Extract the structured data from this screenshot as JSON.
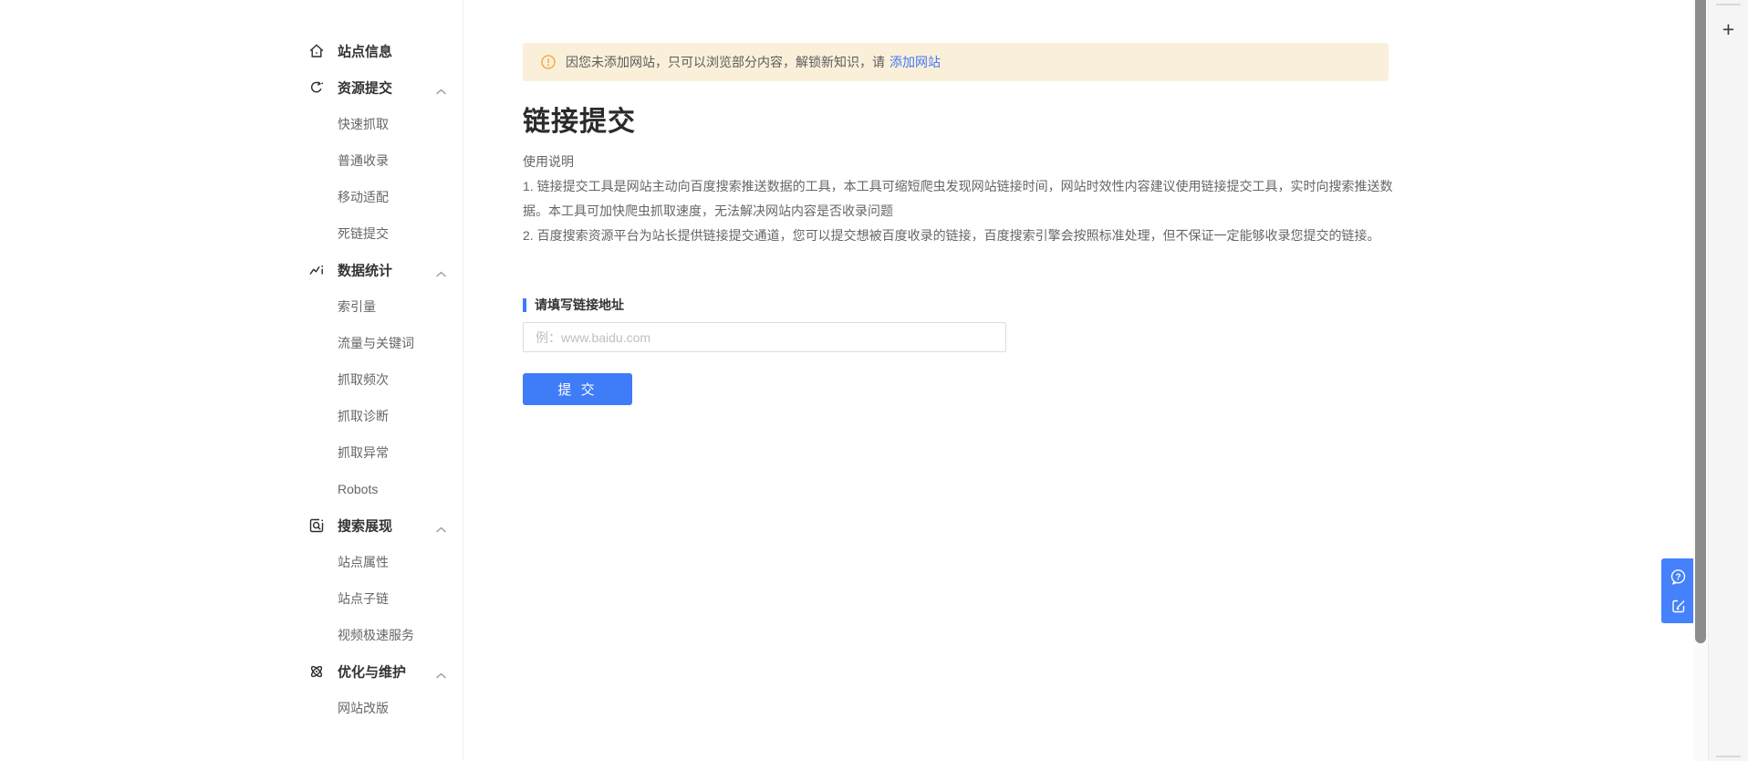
{
  "colors": {
    "accent_blue": "#3e7cf8",
    "link_blue": "#4377f6",
    "float_panel_blue": "#4481fb",
    "banner_bg": "#faf0da",
    "warning_orange": "#f0a32f",
    "section_text": "#333333",
    "subitem_text": "#666666"
  },
  "sidebar": {
    "items": [
      {
        "type": "section",
        "name": "site-info",
        "icon": "home-icon",
        "label": "站点信息",
        "chevron": false
      },
      {
        "type": "section",
        "name": "resource-submit",
        "icon": "resource-submit-icon",
        "label": "资源提交",
        "chevron": true
      },
      {
        "type": "item",
        "name": "quick-crawl",
        "label": "快速抓取"
      },
      {
        "type": "item",
        "name": "normal-include",
        "label": "普通收录"
      },
      {
        "type": "item",
        "name": "mobile-adapt",
        "label": "移动适配"
      },
      {
        "type": "item",
        "name": "dead-link-submit",
        "label": "死链提交"
      },
      {
        "type": "section",
        "name": "data-stats",
        "icon": "data-stats-icon",
        "label": "数据统计",
        "chevron": true
      },
      {
        "type": "item",
        "name": "index-volume",
        "label": "索引量"
      },
      {
        "type": "item",
        "name": "traffic-keywords",
        "label": "流量与关键词"
      },
      {
        "type": "item",
        "name": "crawl-frequency",
        "label": "抓取频次"
      },
      {
        "type": "item",
        "name": "crawl-diagnosis",
        "label": "抓取诊断"
      },
      {
        "type": "item",
        "name": "crawl-exception",
        "label": "抓取异常"
      },
      {
        "type": "item",
        "name": "robots",
        "label": "Robots"
      },
      {
        "type": "section",
        "name": "search-display",
        "icon": "search-display-icon",
        "label": "搜索展现",
        "chevron": true
      },
      {
        "type": "item",
        "name": "site-attribute",
        "label": "站点属性"
      },
      {
        "type": "item",
        "name": "site-sublink",
        "label": "站点子链"
      },
      {
        "type": "item",
        "name": "video-speed-service",
        "label": "视频极速服务"
      },
      {
        "type": "section",
        "name": "optimize-maintain",
        "icon": "optimize-icon",
        "label": "优化与维护",
        "chevron": true
      },
      {
        "type": "item",
        "name": "site-revamp",
        "label": "网站改版"
      }
    ]
  },
  "banner": {
    "icon": "warning-circle-icon",
    "text": "因您未添加网站，只可以浏览部分内容，解锁新知识，请",
    "link_label": "添加网站"
  },
  "main": {
    "title": "链接提交",
    "usage_heading": "使用说明",
    "instructions": [
      "1. 链接提交工具是网站主动向百度搜索推送数据的工具，本工具可缩短爬虫发现网站链接时间，网站时效性内容建议使用链接提交工具，实时向搜索推送数据。本工具可加快爬虫抓取速度，无法解决网站内容是否收录问题",
      "2. 百度搜索资源平台为站长提供链接提交通道，您可以提交想被百度收录的链接，百度搜索引擎会按照标准处理，但不保证一定能够收录您提交的链接。"
    ],
    "form": {
      "label": "请填写链接地址",
      "placeholder": "例：www.baidu.com",
      "submit_label": "提 交"
    }
  },
  "floating": {
    "help_icon": "help-question-icon",
    "feedback_icon": "feedback-edit-icon"
  },
  "rightbar": {
    "plus_label": "+"
  }
}
